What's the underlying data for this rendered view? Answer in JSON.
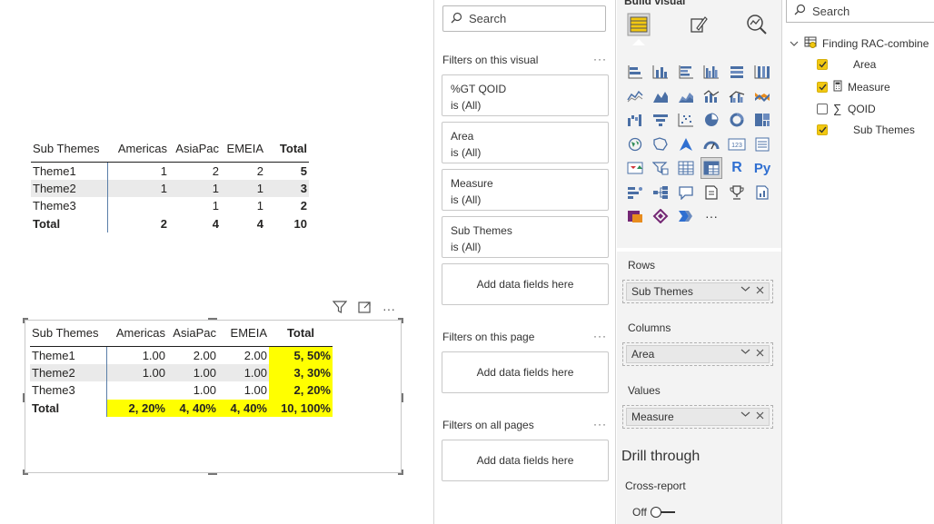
{
  "matrix_top": {
    "columns": [
      "Sub Themes",
      "Americas",
      "AsiaPac",
      "EMEIA",
      "Total"
    ],
    "rows": [
      [
        "Theme1",
        "1",
        "2",
        "2",
        "5"
      ],
      [
        "Theme2",
        "1",
        "1",
        "1",
        "3"
      ],
      [
        "Theme3",
        "",
        "1",
        "1",
        "2"
      ]
    ],
    "total": [
      "Total",
      "2",
      "4",
      "4",
      "10"
    ]
  },
  "matrix_bottom": {
    "columns": [
      "Sub Themes",
      "Americas",
      "AsiaPac",
      "EMEIA",
      "Total"
    ],
    "rows": [
      [
        "Theme1",
        "1.00",
        "2.00",
        "2.00",
        "5, 50%"
      ],
      [
        "Theme2",
        "1.00",
        "1.00",
        "1.00",
        "3, 30%"
      ],
      [
        "Theme3",
        "",
        "1.00",
        "1.00",
        "2, 20%"
      ]
    ],
    "total": [
      "Total",
      "2, 20%",
      "4, 40%",
      "4, 40%",
      "10, 100%"
    ],
    "highlight_color": "#ffff00",
    "header_icons": [
      "filter-icon",
      "focus-mode-icon",
      "more-options-icon"
    ],
    "more_label": "···"
  },
  "filters_pane": {
    "search_placeholder": "Search",
    "on_visual_label": "Filters on this visual",
    "on_page_label": "Filters on this page",
    "on_all_pages_label": "Filters on all pages",
    "more_label": "···",
    "visual_filters": [
      {
        "name": "%GT QOID",
        "state": "is (All)"
      },
      {
        "name": "Area",
        "state": "is (All)"
      },
      {
        "name": "Measure",
        "state": "is (All)"
      },
      {
        "name": "Sub Themes",
        "state": "is (All)"
      }
    ],
    "add_fields_label": "Add data fields here"
  },
  "build_pane": {
    "title": "Build visual",
    "rows_label": "Rows",
    "rows_field": "Sub Themes",
    "columns_label": "Columns",
    "columns_field": "Area",
    "values_label": "Values",
    "values_field": "Measure",
    "drill_through": "Drill through",
    "cross_report": "Cross-report",
    "off_label": "Off",
    "visual_icons": [
      "stacked-bar-icon",
      "stacked-column-icon",
      "clustered-bar-icon",
      "clustered-column-icon",
      "100-bar-icon",
      "100-column-icon",
      "line-icon",
      "area-icon",
      "stacked-area-icon",
      "line-column-icon",
      "line-clustered-icon",
      "ribbon-icon",
      "waterfall-icon",
      "funnel-icon",
      "scatter-icon",
      "pie-icon",
      "donut-icon",
      "treemap-icon",
      "map-icon",
      "filled-map-icon",
      "azure-map-icon",
      "gauge-icon",
      "card-icon",
      "multirow-card-icon",
      "kpi-icon",
      "slicer-icon",
      "table-icon",
      "matrix-icon",
      "r-visual-icon",
      "python-visual-icon",
      "key-influencers-icon",
      "decomposition-tree-icon",
      "qa-icon",
      "smart-narrative-icon",
      "trophy-icon",
      "paginated-report-icon",
      "power-apps-icon",
      "power-automate-icon",
      "power-bi-visual-icon",
      "more-visuals-icon"
    ],
    "glyph_r": "R",
    "glyph_py": "Py",
    "glyph_123": "123",
    "glyph_more": "···"
  },
  "data_pane": {
    "search_placeholder": "Search",
    "table_name": "Finding RAC-combine",
    "fields": [
      {
        "name": "Area",
        "checked": true,
        "icon": ""
      },
      {
        "name": "Measure",
        "checked": true,
        "icon": "calculator-icon"
      },
      {
        "name": "QOID",
        "checked": false,
        "icon": "sigma-icon"
      },
      {
        "name": "Sub Themes",
        "checked": true,
        "icon": ""
      }
    ],
    "sigma_glyph": "∑"
  },
  "accent_color": "#f2c811"
}
